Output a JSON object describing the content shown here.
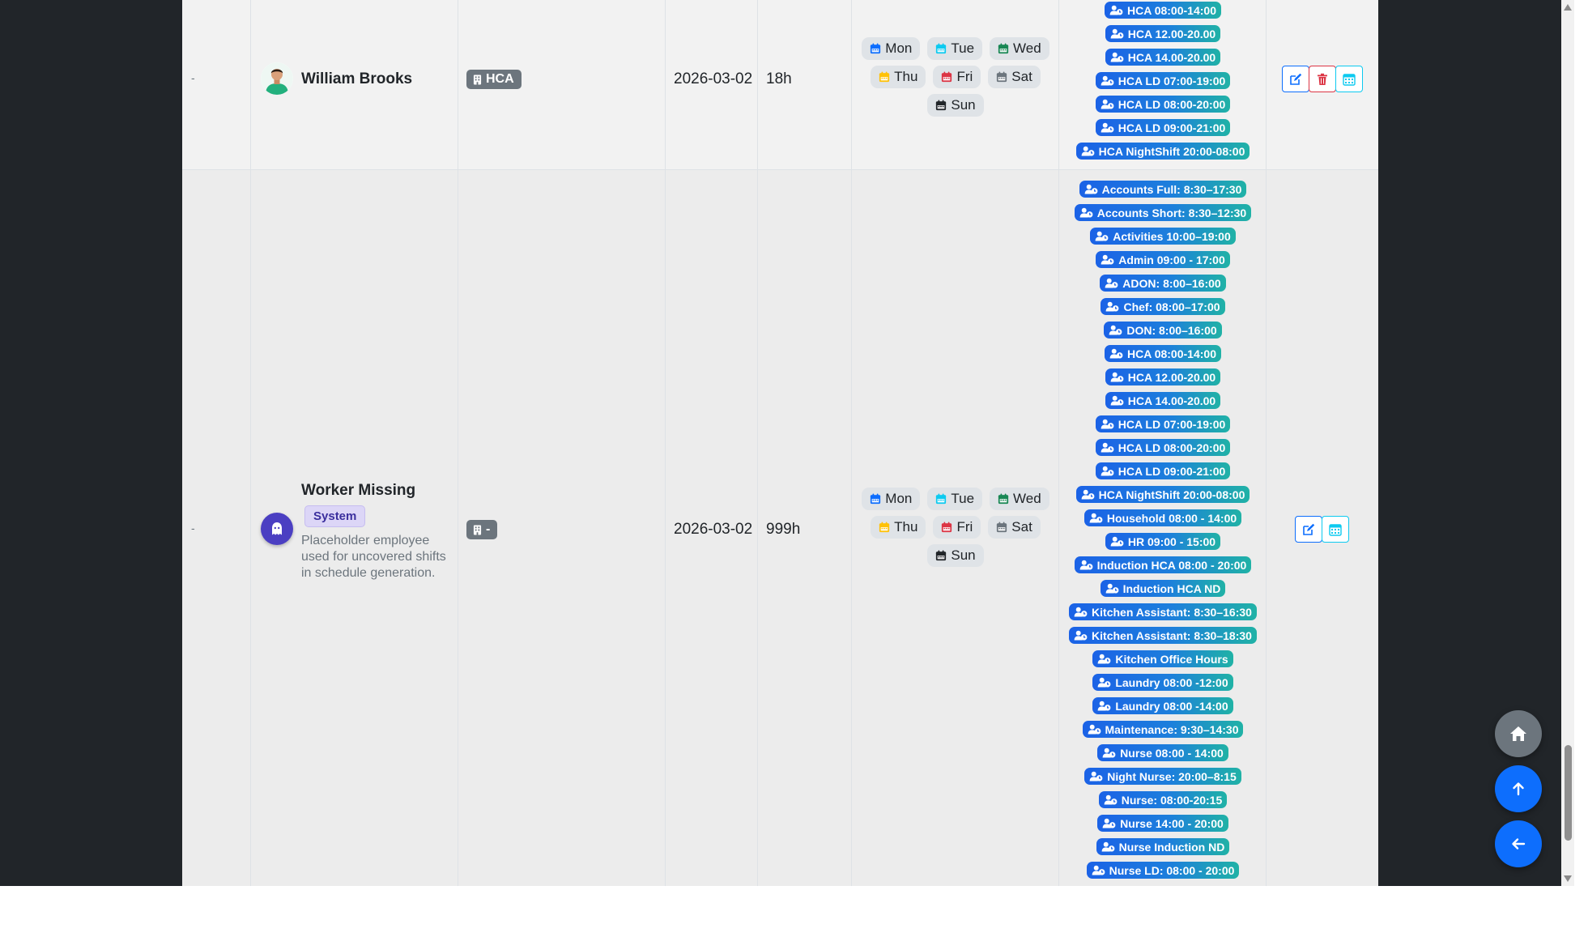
{
  "rows": [
    {
      "index": "-",
      "name": "William Brooks",
      "department": "HCA",
      "start_date": "2026-03-02",
      "hours": "18h",
      "days": [
        "Mon",
        "Tue",
        "Wed",
        "Thu",
        "Fri",
        "Sat",
        "Sun"
      ],
      "shifts": [
        "HCA 08:00-14:00",
        "HCA 12.00-20.00",
        "HCA 14.00-20.00",
        "HCA LD 07:00-19:00",
        "HCA LD 08:00-20:00",
        "HCA LD 09:00-21:00",
        "HCA NightShift 20:00-08:00"
      ]
    },
    {
      "index": "-",
      "name": "Worker Missing",
      "badge": "System",
      "description": "Placeholder employee used for uncovered shifts in schedule generation.",
      "department": "-",
      "start_date": "2026-03-02",
      "hours": "999h",
      "days": [
        "Mon",
        "Tue",
        "Wed",
        "Thu",
        "Fri",
        "Sat",
        "Sun"
      ],
      "shifts": [
        "Accounts Full: 8:30–17:30",
        "Accounts Short: 8:30–12:30",
        "Activities 10:00–19:00",
        "Admin 09:00 - 17:00",
        "ADON: 8:00–16:00",
        "Chef: 08:00–17:00",
        "DON: 8:00–16:00",
        "HCA 08:00-14:00",
        "HCA 12.00-20.00",
        "HCA 14.00-20.00",
        "HCA LD 07:00-19:00",
        "HCA LD 08:00-20:00",
        "HCA LD 09:00-21:00",
        "HCA NightShift 20:00-08:00",
        "Household 08:00 - 14:00",
        "HR 09:00 - 15:00",
        "Induction HCA 08:00 - 20:00",
        "Induction HCA ND",
        "Kitchen Assistant: 8:30–16:30",
        "Kitchen Assistant: 8:30–18:30",
        "Kitchen Office Hours",
        "Laundry 08:00 -12:00",
        "Laundry 08:00 -14:00",
        "Maintenance: 9:30–14:30",
        "Nurse 08:00 - 14:00",
        "Night Nurse: 20:00–8:15",
        "Nurse: 08:00-20:15",
        "Nurse 14:00 - 20:00",
        "Nurse Induction ND",
        "Nurse LD: 08:00 - 20:00"
      ]
    }
  ],
  "day_colors": {
    "Mon": "#0d6efd",
    "Tue": "#0dcaf0",
    "Wed": "#198754",
    "Thu": "#ffc107",
    "Fri": "#dc3545",
    "Sat": "#6c757d",
    "Sun": "#212529"
  },
  "icons": {
    "department": "building-icon",
    "day": "calendar-icon",
    "shift": "user-clock-icon",
    "edit": "edit-icon",
    "delete": "trash-icon",
    "schedule": "calendar-grid-icon",
    "home": "home-icon",
    "top": "arrow-up-icon",
    "back": "arrow-left-icon"
  }
}
